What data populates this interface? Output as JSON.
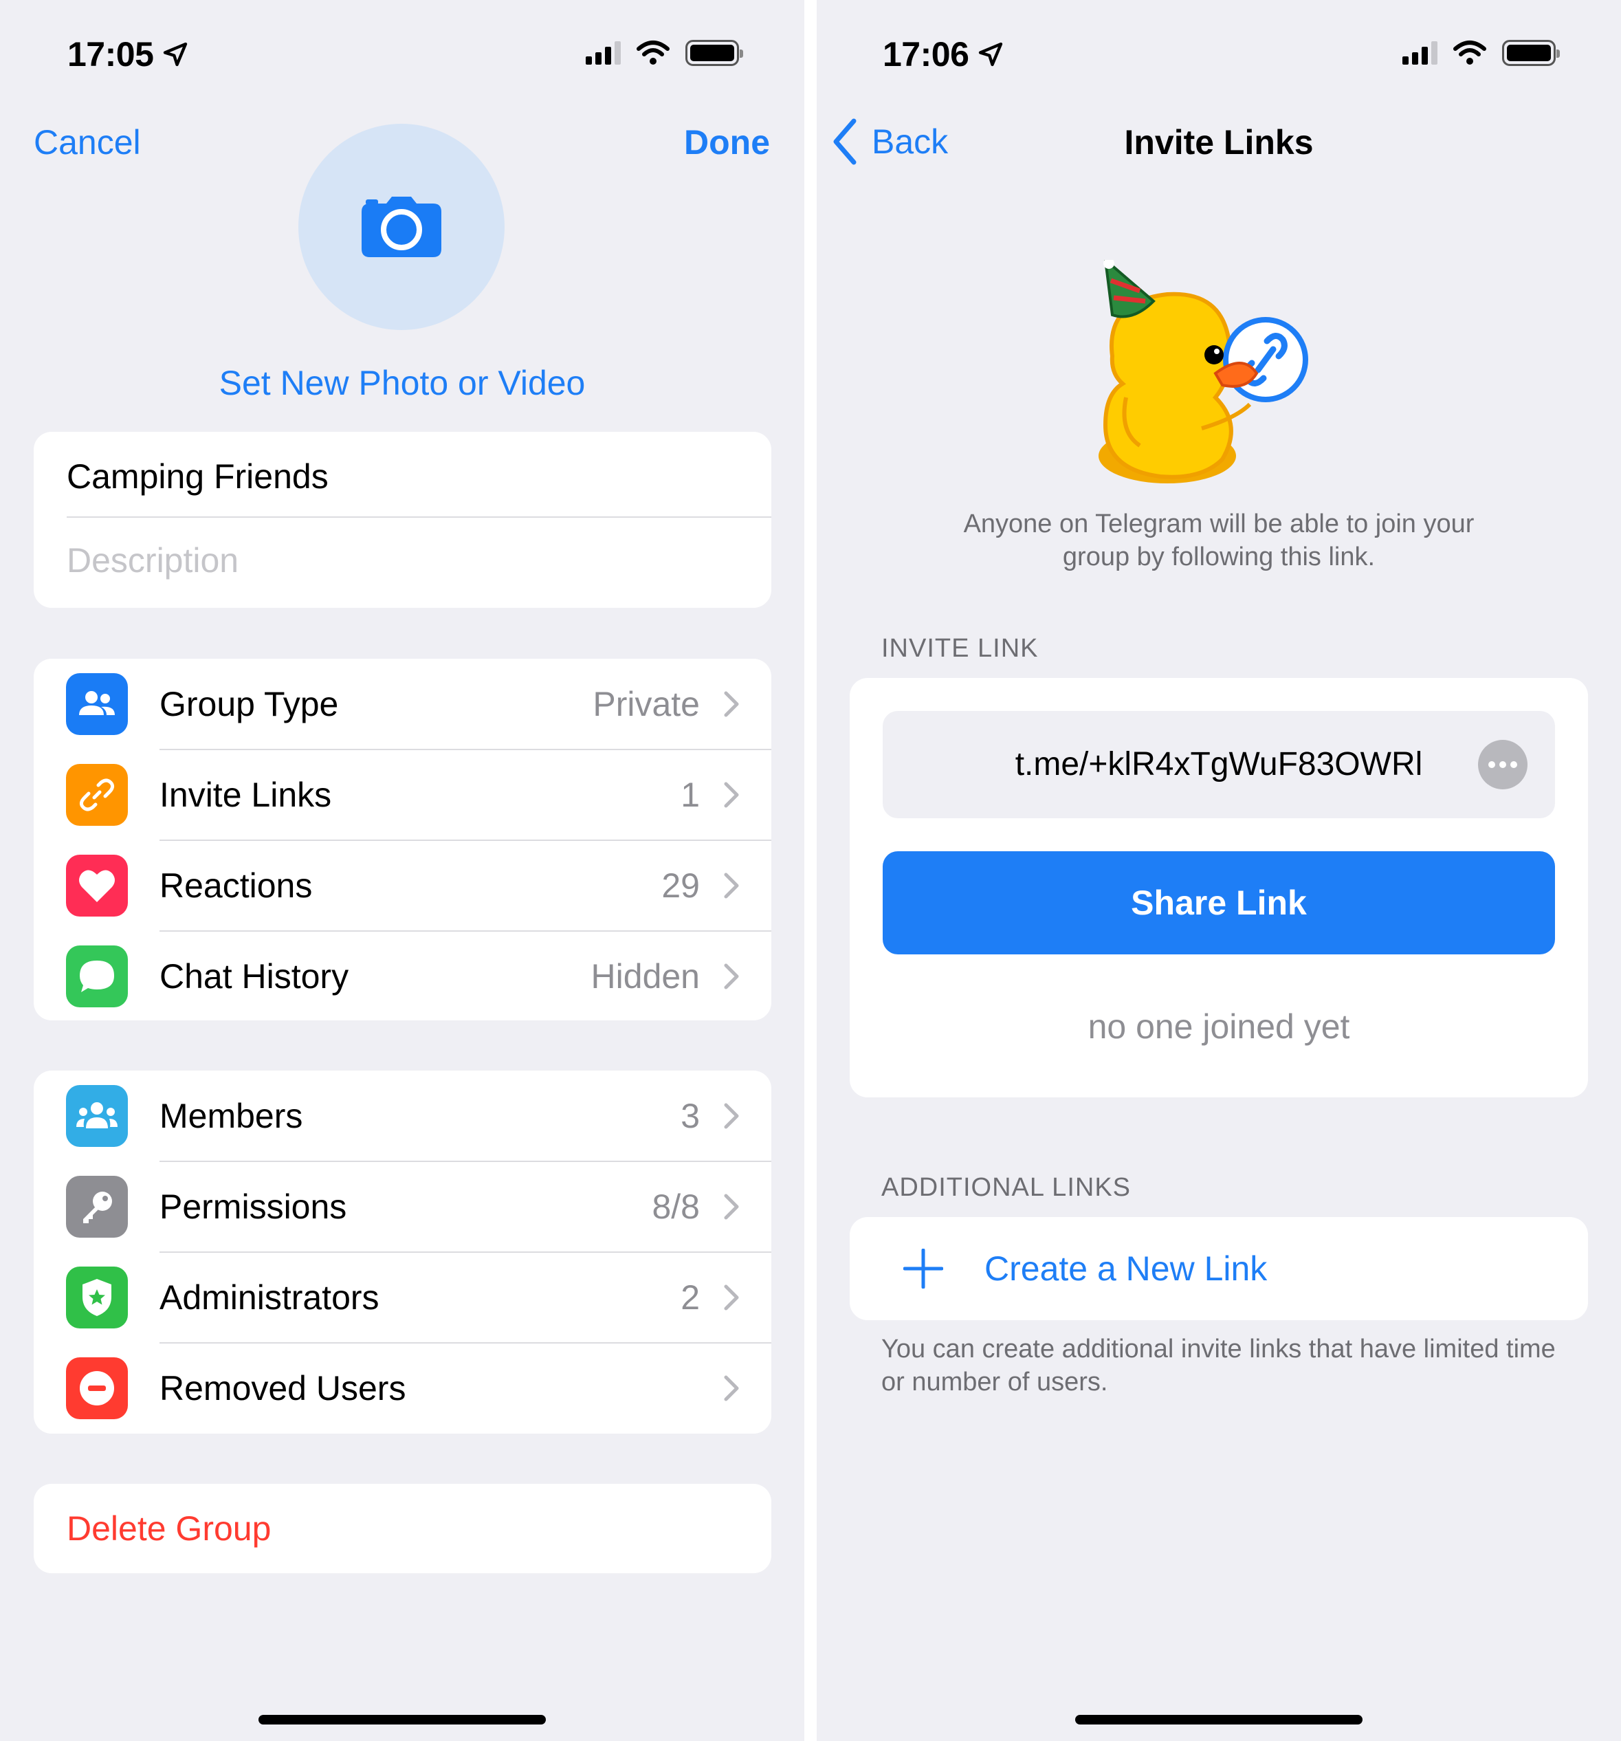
{
  "left": {
    "status": {
      "time": "17:05"
    },
    "nav": {
      "cancel": "Cancel",
      "done": "Done"
    },
    "photo_label": "Set New Photo or Video",
    "info": {
      "name": "Camping Friends",
      "description_placeholder": "Description"
    },
    "settings": [
      {
        "label": "Group Type",
        "value": "Private",
        "icon": "group-type-icon",
        "color": "#1a7cf5"
      },
      {
        "label": "Invite Links",
        "value": "1",
        "icon": "link-icon",
        "color": "#ff9500"
      },
      {
        "label": "Reactions",
        "value": "29",
        "icon": "heart-icon",
        "color": "#ff2d55"
      },
      {
        "label": "Chat History",
        "value": "Hidden",
        "icon": "chat-bubble-icon",
        "color": "#34c759"
      }
    ],
    "management": [
      {
        "label": "Members",
        "value": "3",
        "icon": "members-icon",
        "color": "#32ade6"
      },
      {
        "label": "Permissions",
        "value": "8/8",
        "icon": "key-icon",
        "color": "#8e8e93"
      },
      {
        "label": "Administrators",
        "value": "2",
        "icon": "shield-star-icon",
        "color": "#30c048"
      },
      {
        "label": "Removed Users",
        "value": "",
        "icon": "minus-circle-icon",
        "color": "#ff3b30"
      }
    ],
    "delete_label": "Delete Group"
  },
  "right": {
    "status": {
      "time": "17:06"
    },
    "nav": {
      "back": "Back",
      "title": "Invite Links"
    },
    "description": "Anyone on Telegram will be able to join your group by following this link.",
    "invite_header": "INVITE LINK",
    "link": "t.me/+klR4xTgWuF83OWRl",
    "share_label": "Share Link",
    "joined_status": "no one joined yet",
    "additional_header": "ADDITIONAL LINKS",
    "create_label": "Create a New Link",
    "footer": "You can create additional invite links that have limited time or number of users."
  },
  "colors": {
    "accent": "#1e7ef6",
    "destructive": "#ff3b30",
    "background": "#efeff4"
  }
}
